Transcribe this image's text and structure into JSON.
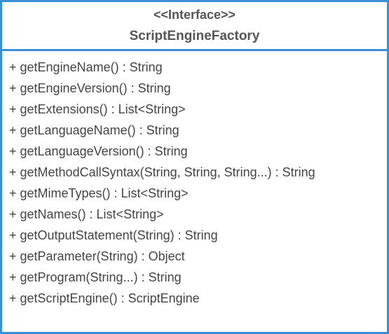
{
  "class": {
    "stereotype": "<<Interface>>",
    "name": "ScriptEngineFactory",
    "operations": [
      "+ getEngineName() : String",
      "+ getEngineVersion() : String",
      "+ getExtensions() : List<String>",
      "+ getLanguageName() : String",
      "+ getLanguageVersion() : String",
      "+ getMethodCallSyntax(String, String, String...) : String",
      "+ getMimeTypes() : List<String>",
      "+ getNames() : List<String>",
      "+ getOutputStatement(String) : String",
      "+ getParameter(String) : Object",
      "+ getProgram(String...) : String",
      "+ getScriptEngine() : ScriptEngine"
    ]
  },
  "colors": {
    "border": "#3b8fd6",
    "text": "#444444",
    "header_text": "#555555"
  }
}
